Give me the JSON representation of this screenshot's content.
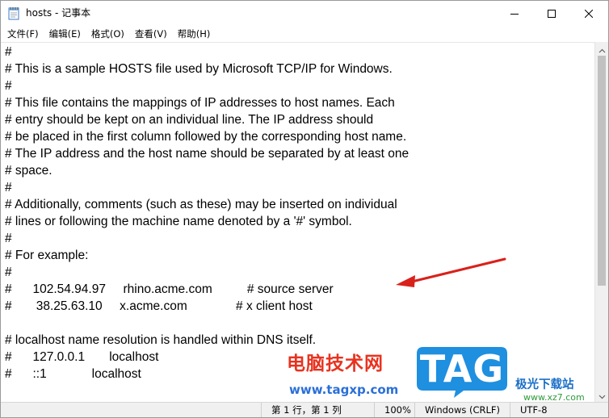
{
  "window": {
    "title": "hosts - 记事本",
    "icons": {
      "app": "notepad-icon",
      "minimize": "minimize-icon",
      "maximize": "maximize-icon",
      "close": "close-icon"
    }
  },
  "menu": {
    "items": [
      "文件(F)",
      "编辑(E)",
      "格式(O)",
      "查看(V)",
      "帮助(H)"
    ]
  },
  "editor": {
    "lines": [
      "#",
      "# This is a sample HOSTS file used by Microsoft TCP/IP for Windows.",
      "#",
      "# This file contains the mappings of IP addresses to host names. Each",
      "# entry should be kept on an individual line. The IP address should",
      "# be placed in the first column followed by the corresponding host name.",
      "# The IP address and the host name should be separated by at least one",
      "# space.",
      "#",
      "# Additionally, comments (such as these) may be inserted on individual",
      "# lines or following the machine name denoted by a '#' symbol.",
      "#",
      "# For example:",
      "#",
      "#      102.54.94.97     rhino.acme.com          # source server",
      "#       38.25.63.10     x.acme.com              # x client host",
      "",
      "# localhost name resolution is handled within DNS itself.",
      "#\t127.0.0.1       localhost",
      "#\t::1             localhost"
    ]
  },
  "statusbar": {
    "position": "第 1 行，第 1 列",
    "zoom": "100%",
    "line_ending": "Windows (CRLF)",
    "encoding": "UTF-8"
  },
  "annotation": {
    "arrow_color": "#d9211b"
  },
  "watermark": {
    "site_name": "电脑技术网",
    "site_url": "www.tagxp.com",
    "logo_text": "TAG",
    "logo_color": "#1f8fe0",
    "corner_name": "极光下载站",
    "corner_url": "www.xz7.com"
  }
}
